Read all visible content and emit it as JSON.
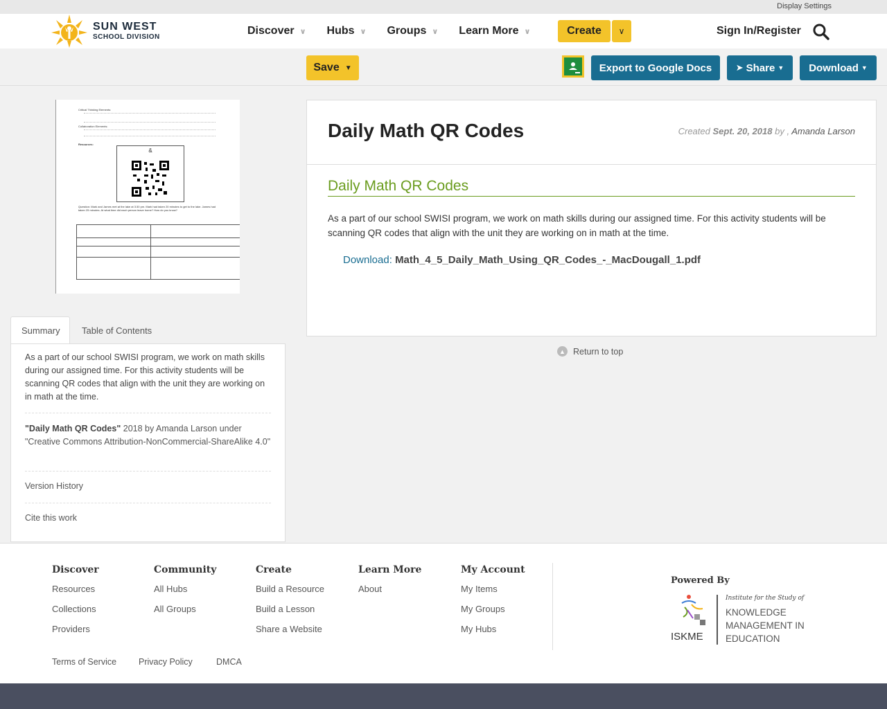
{
  "util": {
    "display_settings": "Display Settings"
  },
  "header": {
    "logo_line1": "SUN WEST",
    "logo_line2": "SCHOOL DIVISION",
    "nav": [
      "Discover",
      "Hubs",
      "Groups",
      "Learn More"
    ],
    "create": "Create",
    "signin": "Sign In/Register"
  },
  "toolbar": {
    "save": "Save",
    "export": "Export to Google Docs",
    "share": "Share",
    "download": "Download"
  },
  "thumbnail": {
    "heading1": "Critical Thinking Elements:",
    "heading2": "Collaboration Elements:",
    "resources": "Resources:",
    "amp": "&",
    "question": "Question: Mark and James met at the lake at 3:30 pm. Mark had taken 20 minutes to get to the lake. James had taken 25 minutes. At what time did each person leave home? How do you know?"
  },
  "tabs": {
    "summary": "Summary",
    "toc": "Table of Contents"
  },
  "summary": {
    "text": "As a part of our school SWISI program, we work on math skills during our assigned time. For this activity students will be scanning QR codes that align with the unit they are working on in math at the time.",
    "cite_title": "\"Daily Math QR Codes\"",
    "cite_rest": " 2018 by Amanda Larson under \"Creative Commons Attribution-NonCommercial-ShareAlike 4.0\"",
    "version_history": "Version History",
    "cite_work": "Cite this work"
  },
  "main": {
    "title": "Daily Math QR Codes",
    "created_label": "Created",
    "created_date": "Sept. 20, 2018",
    "by": "by ,",
    "author": "Amanda Larson",
    "section_title": "Daily Math QR Codes",
    "body": "As a part of our school SWISI program, we work on math skills during our assigned time. For this activity students will be scanning QR codes that align with the unit they are working on in math at the time.",
    "download_label": "Download:",
    "download_file": "Math_4_5_Daily_Math_Using_QR_Codes_-_MacDougall_1.pdf",
    "return_top": "Return to top"
  },
  "footer": {
    "discover": {
      "title": "Discover",
      "links": [
        "Resources",
        "Collections",
        "Providers"
      ]
    },
    "community": {
      "title": "Community",
      "links": [
        "All Hubs",
        "All Groups"
      ]
    },
    "create": {
      "title": "Create",
      "links": [
        "Build a Resource",
        "Build a Lesson",
        "Share a Website"
      ]
    },
    "learn": {
      "title": "Learn More",
      "links": [
        "About"
      ]
    },
    "account": {
      "title": "My Account",
      "links": [
        "My Items",
        "My Groups",
        "My Hubs"
      ]
    },
    "powered_by": "Powered By",
    "iskme_sub": "Institute for the Study of",
    "iskme_l1": "KNOWLEDGE",
    "iskme_l2": "MANAGEMENT IN",
    "iskme_l3": "EDUCATION",
    "iskme_abbr": "ISKME",
    "legal": [
      "Terms of Service",
      "Privacy Policy",
      "DMCA"
    ]
  },
  "colors": {
    "accent_yellow": "#f3c32a",
    "primary_blue": "#196d91",
    "section_green": "#6a9c1e",
    "footer_bar": "#4a4f60"
  }
}
